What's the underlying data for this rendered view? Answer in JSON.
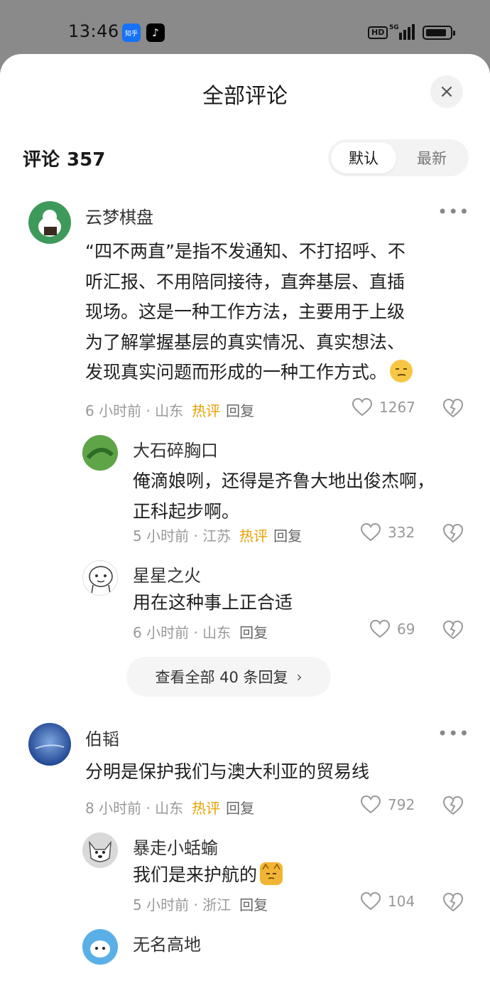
{
  "status_bar": {
    "time": "13:46",
    "apps": [
      {
        "icon": "zhihu-icon",
        "label": "知乎"
      },
      {
        "icon": "tiktok-icon",
        "label": "♪"
      }
    ],
    "hd_badge": "HD",
    "network": "5G"
  },
  "sheet": {
    "title": "全部评论",
    "close_icon": "×",
    "count_label": "评论",
    "count_value": "357",
    "sort_options": [
      "默认",
      "最新"
    ],
    "sort_selected": "默认"
  },
  "comments": [
    {
      "user": "云梦棋盘",
      "text_lines": [
        "“四不两直”是指不发通知、不打招呼、不",
        "听汇报、不用陪同接待，直奔基层、直插",
        "现场。这是一种工作方法，主要用于上级",
        "为了解掌握基层的真实情况、真实想法、",
        "发现真实问题而形成的一种工作方式。"
      ],
      "emoji": "smirk-emoji",
      "time": "6 小时前",
      "location": "山东",
      "hot": "热评",
      "reply": "回复",
      "likes": "1267",
      "replies": [
        {
          "user": "大石碎胸口",
          "text_lines": [
            "俺滴娘咧，还得是齐鲁大地出俊杰啊，",
            "正科起步啊。"
          ],
          "time": "5 小时前",
          "location": "江苏",
          "hot": "热评",
          "reply": "回复",
          "likes": "332"
        },
        {
          "user": "星星之火",
          "text_lines": [
            "用在这种事上正合适"
          ],
          "time": "6 小时前",
          "location": "山东",
          "reply": "回复",
          "likes": "69"
        }
      ],
      "view_all": "查看全部 40 条回复"
    },
    {
      "user": "伯韬",
      "text_lines": [
        "分明是保护我们与澳大利亚的贸易线"
      ],
      "time": "8 小时前",
      "location": "山东",
      "hot": "热评",
      "reply": "回复",
      "likes": "792",
      "replies": [
        {
          "user": "暴走小蛞蝓",
          "text_lines": [
            "我们是来护航的"
          ],
          "emoji": "cat-emoji",
          "time": "5 小时前",
          "location": "浙江",
          "reply": "回复",
          "likes": "104"
        },
        {
          "user": "无名高地"
        }
      ]
    }
  ],
  "colors": {
    "hot": "#e8a000",
    "meta": "#999999",
    "sheet_bg": "#ffffff",
    "backdrop": "#8a8a8a"
  }
}
